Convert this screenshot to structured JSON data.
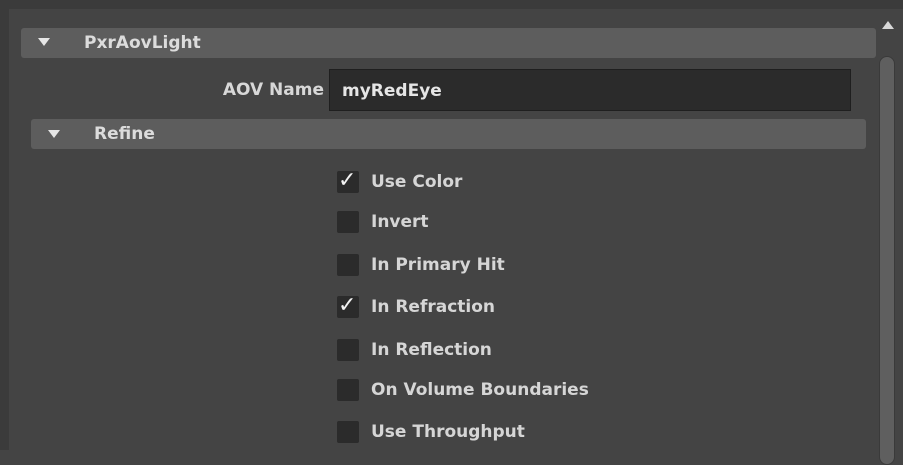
{
  "panel": {
    "title": "PxrAovLight",
    "aov_name_label": "AOV Name",
    "aov_name_value": "myRedEye",
    "refine_title": "Refine"
  },
  "checkboxes": [
    {
      "label": "Use Color",
      "checked": true
    },
    {
      "label": "Invert",
      "checked": false
    },
    {
      "label": "In Primary Hit",
      "checked": false
    },
    {
      "label": "In Refraction",
      "checked": true
    },
    {
      "label": "In Reflection",
      "checked": false
    },
    {
      "label": "On Volume Boundaries",
      "checked": false
    },
    {
      "label": "Use Throughput",
      "checked": false
    }
  ],
  "check_glyph": "✓"
}
